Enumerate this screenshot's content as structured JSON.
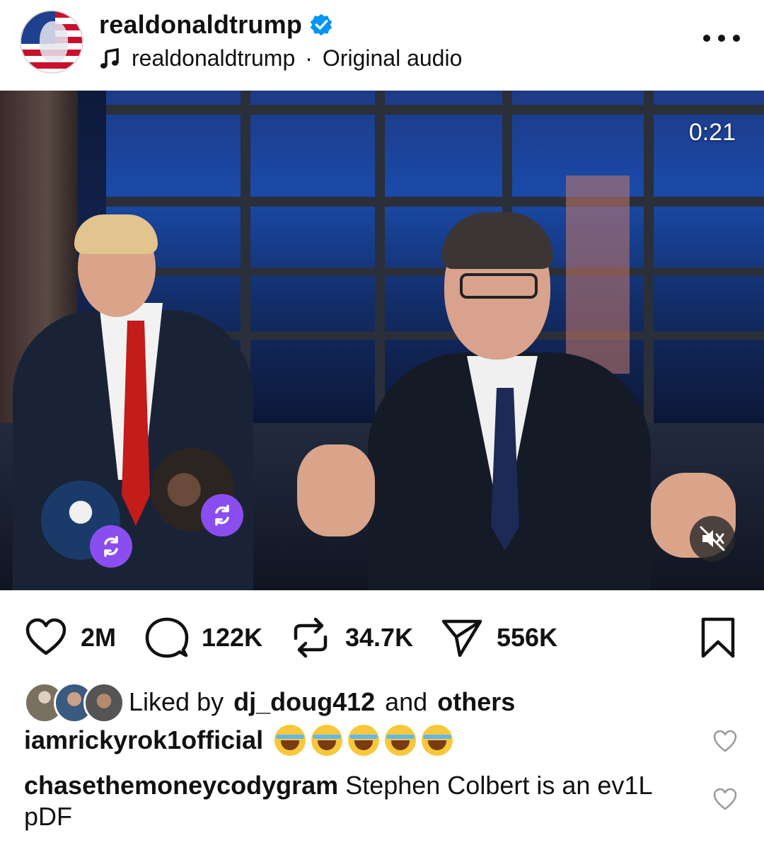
{
  "header": {
    "username": "realdonaldtrump",
    "audio_owner": "realdonaldtrump",
    "audio_separator": "·",
    "audio_label": "Original audio"
  },
  "video": {
    "timestamp": "0:21",
    "muted": true
  },
  "actions": {
    "likes": "2M",
    "comments": "122K",
    "reposts": "34.7K",
    "shares": "556K"
  },
  "liked_by": {
    "prefix": "Liked by",
    "user": "dj_doug412",
    "middle": "and",
    "others": "others"
  },
  "comments": [
    {
      "user": "iamrickyrok1official",
      "text": "",
      "emoji_count": 5
    },
    {
      "user": "chasethemoneycodygram",
      "text": "Stephen Colbert is an ev1L pDF"
    }
  ],
  "colors": {
    "accent_purple": "#8a4df0",
    "verified_blue": "#0095f6",
    "tie_red": "#c41b1b"
  },
  "icons": [
    "verified-icon",
    "music-note-icon",
    "more-icon",
    "mute-icon",
    "repost-icon",
    "heart-icon",
    "comment-icon",
    "share-icon",
    "bookmark-icon"
  ]
}
